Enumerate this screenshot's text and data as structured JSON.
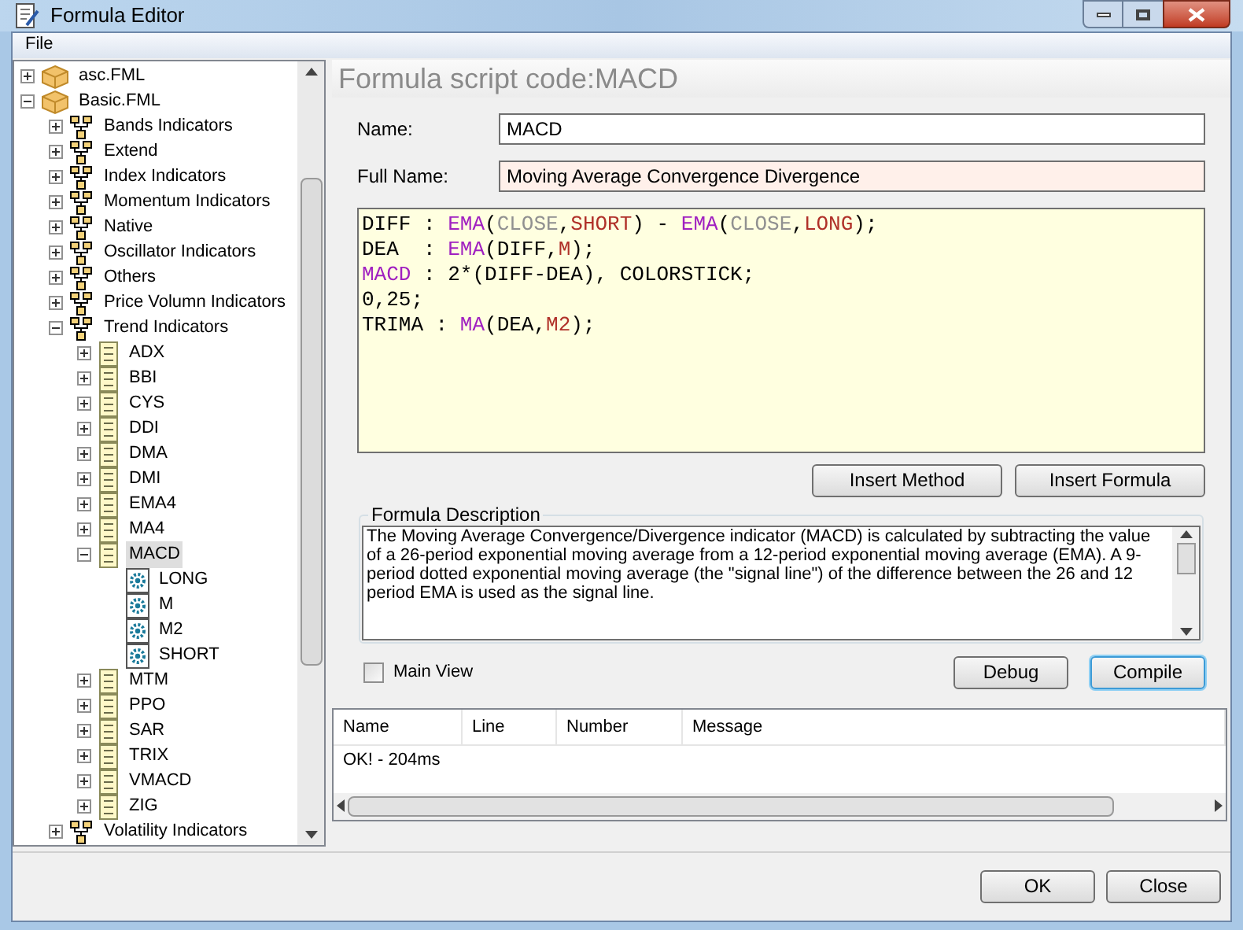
{
  "window": {
    "title": "Formula Editor"
  },
  "menu": [
    "File"
  ],
  "tree": [
    {
      "label": "asc.FML",
      "kind": "file",
      "expanded": false,
      "selected": false
    },
    {
      "label": "Basic.FML",
      "kind": "file",
      "expanded": true,
      "selected": false,
      "children": [
        {
          "label": "Bands Indicators",
          "kind": "folder",
          "expanded": false,
          "selected": false
        },
        {
          "label": "Extend",
          "kind": "folder",
          "expanded": false,
          "selected": false
        },
        {
          "label": "Index Indicators",
          "kind": "folder",
          "expanded": false,
          "selected": false
        },
        {
          "label": "Momentum Indicators",
          "kind": "folder",
          "expanded": false,
          "selected": false
        },
        {
          "label": "Native",
          "kind": "folder",
          "expanded": false,
          "selected": false
        },
        {
          "label": "Oscillator Indicators",
          "kind": "folder",
          "expanded": false,
          "selected": false
        },
        {
          "label": "Others",
          "kind": "folder",
          "expanded": false,
          "selected": false
        },
        {
          "label": "Price Volumn Indicators",
          "kind": "folder",
          "expanded": false,
          "selected": false
        },
        {
          "label": "Trend Indicators",
          "kind": "folder",
          "expanded": true,
          "selected": false,
          "children": [
            {
              "label": "ADX",
              "kind": "formula",
              "expanded": false,
              "selected": false
            },
            {
              "label": "BBI",
              "kind": "formula",
              "expanded": false,
              "selected": false
            },
            {
              "label": "CYS",
              "kind": "formula",
              "expanded": false,
              "selected": false
            },
            {
              "label": "DDI",
              "kind": "formula",
              "expanded": false,
              "selected": false
            },
            {
              "label": "DMA",
              "kind": "formula",
              "expanded": false,
              "selected": false
            },
            {
              "label": "DMI",
              "kind": "formula",
              "expanded": false,
              "selected": false
            },
            {
              "label": "EMA4",
              "kind": "formula",
              "expanded": false,
              "selected": false
            },
            {
              "label": "MA4",
              "kind": "formula",
              "expanded": false,
              "selected": false
            },
            {
              "label": "MACD",
              "kind": "formula",
              "expanded": true,
              "selected": true,
              "children": [
                {
                  "label": "LONG",
                  "kind": "param",
                  "selected": false
                },
                {
                  "label": "M",
                  "kind": "param",
                  "selected": false
                },
                {
                  "label": "M2",
                  "kind": "param",
                  "selected": false
                },
                {
                  "label": "SHORT",
                  "kind": "param",
                  "selected": false
                }
              ]
            },
            {
              "label": "MTM",
              "kind": "formula",
              "expanded": false,
              "selected": false
            },
            {
              "label": "PPO",
              "kind": "formula",
              "expanded": false,
              "selected": false
            },
            {
              "label": "SAR",
              "kind": "formula",
              "expanded": false,
              "selected": false
            },
            {
              "label": "TRIX",
              "kind": "formula",
              "expanded": false,
              "selected": false
            },
            {
              "label": "VMACD",
              "kind": "formula",
              "expanded": false,
              "selected": false
            },
            {
              "label": "ZIG",
              "kind": "formula",
              "expanded": false,
              "selected": false
            }
          ]
        },
        {
          "label": "Volatility Indicators",
          "kind": "folder",
          "expanded": false,
          "selected": false
        }
      ]
    }
  ],
  "editor": {
    "heading": "Formula script code:MACD",
    "fields": [
      {
        "label": "Name:",
        "value": "MACD",
        "required": false
      },
      {
        "label": "Full Name:",
        "value": "Moving Average Convergence Divergence",
        "required": true
      }
    ],
    "code_lines": [
      [
        {
          "text": "DIFF : ",
          "kind": "plain"
        },
        {
          "text": "EMA",
          "kind": "function"
        },
        {
          "text": "(",
          "kind": "plain"
        },
        {
          "text": "CLOSE",
          "kind": "data"
        },
        {
          "text": ",",
          "kind": "plain"
        },
        {
          "text": "SHORT",
          "kind": "param"
        },
        {
          "text": ") - ",
          "kind": "plain"
        },
        {
          "text": "EMA",
          "kind": "function"
        },
        {
          "text": "(",
          "kind": "plain"
        },
        {
          "text": "CLOSE",
          "kind": "data"
        },
        {
          "text": ",",
          "kind": "plain"
        },
        {
          "text": "LONG",
          "kind": "param"
        },
        {
          "text": ");",
          "kind": "plain"
        }
      ],
      [
        {
          "text": "DEA  : ",
          "kind": "plain"
        },
        {
          "text": "EMA",
          "kind": "function"
        },
        {
          "text": "(DIFF,",
          "kind": "plain"
        },
        {
          "text": "M",
          "kind": "param"
        },
        {
          "text": ");",
          "kind": "plain"
        }
      ],
      [
        {
          "text": "MACD",
          "kind": "function"
        },
        {
          "text": " : 2*(DIFF-DEA), COLORSTICK;",
          "kind": "plain"
        }
      ],
      [
        {
          "text": "0,25;",
          "kind": "plain"
        }
      ],
      [
        {
          "text": "TRIMA : ",
          "kind": "plain"
        },
        {
          "text": "MA",
          "kind": "function"
        },
        {
          "text": "(DEA,",
          "kind": "plain"
        },
        {
          "text": "M2",
          "kind": "param"
        },
        {
          "text": ");",
          "kind": "plain"
        }
      ]
    ],
    "insert_buttons": [
      "Insert Method",
      "Insert Formula"
    ],
    "description": {
      "legend": "Formula Description",
      "text": "The Moving Average Convergence/Divergence indicator (MACD) is calculated by subtracting the value of a 26-period exponential moving average from a 12-period exponential moving average (EMA). A 9-period dotted exponential moving average (the \"signal line\") of the difference between the 26 and 12 period EMA is used as the signal line."
    },
    "main_view": {
      "label": "Main View",
      "checked": false
    },
    "action_buttons": [
      {
        "label": "Debug",
        "focused": false
      },
      {
        "label": "Compile",
        "focused": true
      }
    ]
  },
  "messages": {
    "columns": [
      "Name",
      "Line",
      "Number",
      "Message"
    ],
    "rows": [
      [
        "OK! - 204ms"
      ]
    ]
  },
  "dialog_buttons": [
    "OK",
    "Close"
  ]
}
